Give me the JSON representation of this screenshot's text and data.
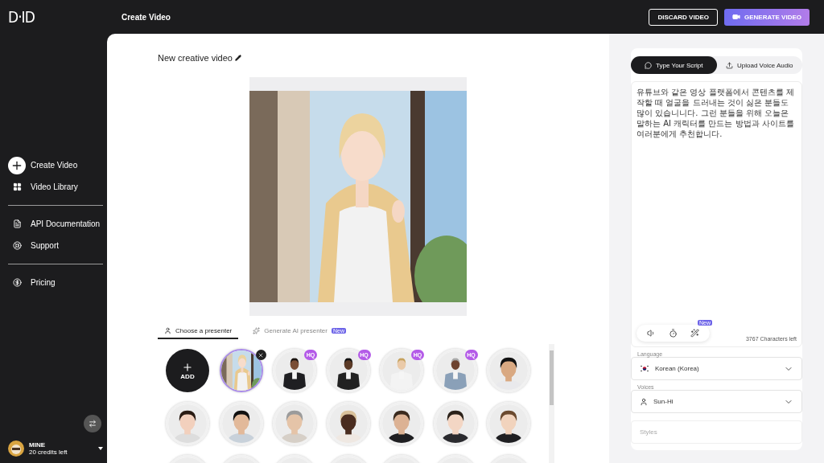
{
  "app": {
    "logo": "D·ID",
    "page_title": "Create Video"
  },
  "top_actions": [
    {
      "label": "DISCARD VIDEO",
      "kind": "outline"
    },
    {
      "label": "GENERATE VIDEO",
      "kind": "primary"
    }
  ],
  "sidebar": {
    "groups": [
      [
        {
          "label": "Create Video"
        },
        {
          "label": "Video Library"
        }
      ],
      [
        {
          "label": "API Documentation"
        },
        {
          "label": "Support"
        }
      ],
      [
        {
          "label": "Pricing"
        }
      ]
    ]
  },
  "user": {
    "name": "MINE",
    "credits": "20 credits left"
  },
  "editor": {
    "title": "New creative video"
  },
  "presenter_tabs": [
    {
      "label": "Choose a presenter",
      "selected": true
    },
    {
      "label": "Generate AI presenter",
      "selected": false,
      "badge": "New"
    }
  ],
  "presenters": [
    {
      "kind": "add",
      "label": "ADD"
    },
    {
      "kind": "presenter",
      "selected": true
    },
    {
      "kind": "presenter",
      "selected": false,
      "badge": "HQ"
    },
    {
      "kind": "presenter",
      "selected": false,
      "badge": "HQ"
    },
    {
      "kind": "presenter",
      "selected": false,
      "badge": "HQ"
    },
    {
      "kind": "presenter",
      "selected": false,
      "badge": "HQ"
    },
    {
      "kind": "presenter",
      "selected": false
    },
    {
      "kind": "presenter",
      "selected": false
    },
    {
      "kind": "presenter",
      "selected": false
    },
    {
      "kind": "presenter",
      "selected": false
    },
    {
      "kind": "presenter",
      "selected": false
    },
    {
      "kind": "presenter",
      "selected": false
    },
    {
      "kind": "presenter",
      "selected": false
    },
    {
      "kind": "presenter",
      "selected": false
    },
    {
      "kind": "presenter",
      "selected": false
    },
    {
      "kind": "presenter",
      "selected": false
    },
    {
      "kind": "presenter",
      "selected": false
    },
    {
      "kind": "presenter",
      "selected": false
    },
    {
      "kind": "presenter",
      "selected": false
    },
    {
      "kind": "presenter",
      "selected": false
    },
    {
      "kind": "presenter",
      "selected": false
    }
  ],
  "script_tabs": [
    {
      "label": "Type Your Script",
      "selected": true
    },
    {
      "label": "Upload Voice Audio",
      "selected": false
    }
  ],
  "script": {
    "text": "유튜브와 같은 영상 플랫폼에서 콘텐츠를 제작할 때 얼굴을 드러내는 것이 싫은 분들도 많이 있습니니다. 그런 분들을 위해 오늘은 말하는 AI 캐릭터를 만드는 방법과 사이트를 여러분에게 추천합니다.",
    "tool_badge": "New",
    "chars_left": "3767 Characters left"
  },
  "language": {
    "label": "Language",
    "value": "Korean (Korea)"
  },
  "voice": {
    "label": "Voices",
    "value": "Sun-Hi"
  },
  "styles": {
    "placeholder": "Styles"
  }
}
